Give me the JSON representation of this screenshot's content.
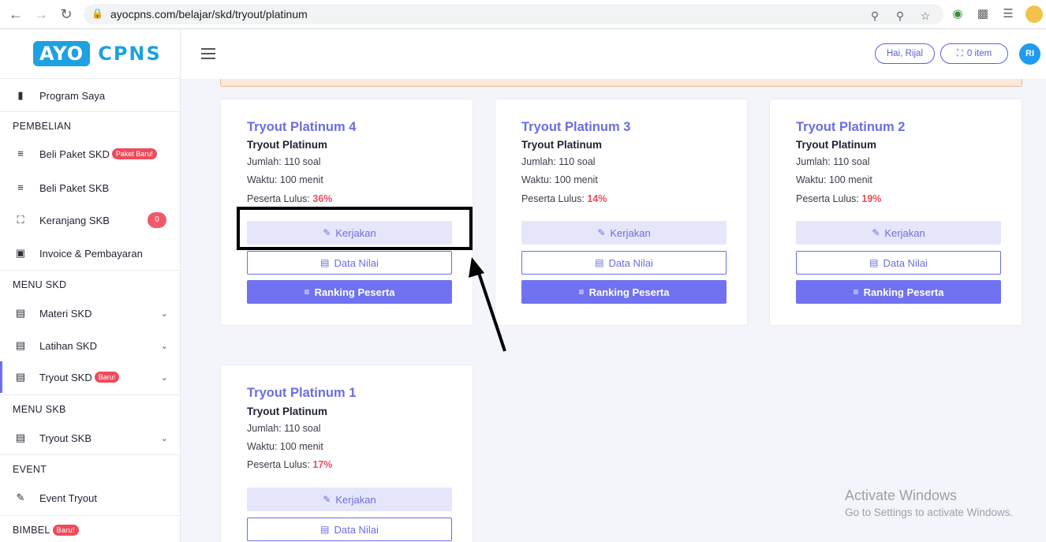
{
  "browser": {
    "url": "ayocpns.com/belajar/skd/tryout/platinum"
  },
  "logo": {
    "left": "AYO",
    "right": "CPNS"
  },
  "sidebar": {
    "program_saya": "Program Saya",
    "section_pembelian": "PEMBELIAN",
    "beli_skd": "Beli Paket SKD",
    "beli_skd_badge": "Paket Baru!",
    "beli_skb": "Beli Paket SKB",
    "keranjang": "Keranjang SKB",
    "keranjang_count": "0",
    "invoice": "Invoice & Pembayaran",
    "section_menu_skd": "MENU SKD",
    "materi_skd": "Materi SKD",
    "latihan_skd": "Latihan SKD",
    "tryout_skd": "Tryout SKD",
    "tryout_skd_badge": "Baru!",
    "section_menu_skb": "MENU SKB",
    "tryout_skb": "Tryout SKB",
    "section_event": "EVENT",
    "event_tryout": "Event Tryout",
    "section_bimbel": "BIMBEL",
    "bimbel_badge": "Baru!"
  },
  "header": {
    "greeting": "Hai, Rijal",
    "cart": "0 item",
    "avatar_initials": "RI"
  },
  "cards": [
    {
      "title": "Tryout Platinum 4",
      "subtitle": "Tryout Platinum",
      "jumlah": "Jumlah: 110 soal",
      "waktu": "Waktu: 100 menit",
      "lulus_label": "Peserta Lulus: ",
      "lulus_pct": "36%",
      "btn_kerjakan": "Kerjakan",
      "btn_nilai": "Data Nilai",
      "btn_ranking": "Ranking Peserta"
    },
    {
      "title": "Tryout Platinum 3",
      "subtitle": "Tryout Platinum",
      "jumlah": "Jumlah: 110 soal",
      "waktu": "Waktu: 100 menit",
      "lulus_label": "Peserta Lulus: ",
      "lulus_pct": "14%",
      "btn_kerjakan": "Kerjakan",
      "btn_nilai": "Data Nilai",
      "btn_ranking": "Ranking Peserta"
    },
    {
      "title": "Tryout Platinum 2",
      "subtitle": "Tryout Platinum",
      "jumlah": "Jumlah: 110 soal",
      "waktu": "Waktu: 100 menit",
      "lulus_label": "Peserta Lulus: ",
      "lulus_pct": "19%",
      "btn_kerjakan": "Kerjakan",
      "btn_nilai": "Data Nilai",
      "btn_ranking": "Ranking Peserta"
    },
    {
      "title": "Tryout Platinum 1",
      "subtitle": "Tryout Platinum",
      "jumlah": "Jumlah: 110 soal",
      "waktu": "Waktu: 100 menit",
      "lulus_label": "Peserta Lulus: ",
      "lulus_pct": "17%",
      "btn_kerjakan": "Kerjakan",
      "btn_nilai": "Data Nilai"
    }
  ],
  "watermark": {
    "line1": "Activate Windows",
    "line2": "Go to Settings to activate Windows."
  }
}
